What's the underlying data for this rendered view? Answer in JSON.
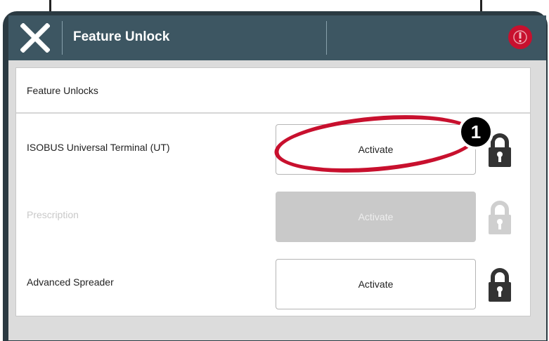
{
  "header": {
    "title": "Feature Unlock"
  },
  "panel": {
    "section_title": "Feature Unlocks",
    "rows": [
      {
        "label": "ISOBUS Universal Terminal (UT)",
        "button": "Activate",
        "enabled": true,
        "locked": true
      },
      {
        "label": "Prescription",
        "button": "Activate",
        "enabled": false,
        "locked": true
      },
      {
        "label": "Advanced Spreader",
        "button": "Activate",
        "enabled": true,
        "locked": true
      }
    ]
  },
  "callout": {
    "number": "1"
  },
  "colors": {
    "header_bg": "#3d5662",
    "frame": "#2b3a42",
    "highlight": "#c8102e",
    "disabled": "#c9c9c9"
  },
  "icons": [
    "close-icon",
    "warning-icon",
    "lock-icon"
  ]
}
